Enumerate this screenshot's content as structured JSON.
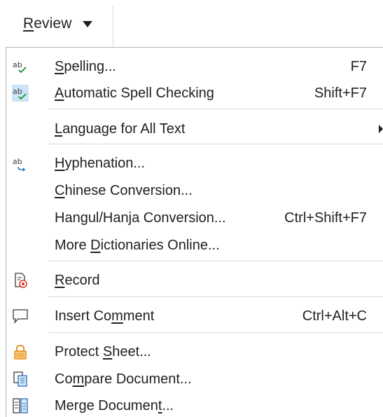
{
  "review_menu": {
    "label_first": "R",
    "label_rest": "eview",
    "caret": "chevron-down-icon"
  },
  "items": [
    {
      "pre": "",
      "u": "S",
      "post": "pelling...",
      "shortcut": "F7",
      "icon": "spelling-icon"
    },
    {
      "pre": "",
      "u": "A",
      "post": "utomatic Spell Checking",
      "shortcut": "Shift+F7",
      "icon": "auto-spellcheck-icon",
      "checked": true
    },
    {
      "pre": "",
      "u": "L",
      "post": "anguage for All Text",
      "shortcut": "",
      "icon": "",
      "submenu": true
    },
    {
      "pre": "",
      "u": "H",
      "post": "yphenation...",
      "shortcut": "",
      "icon": "hyphenation-icon"
    },
    {
      "pre": "",
      "u": "C",
      "post": "hinese Conversion...",
      "shortcut": "",
      "icon": ""
    },
    {
      "pre": "Hangul/Han",
      "u": "j",
      "post": "a Conversion...",
      "shortcut": "Ctrl+Shift+F7",
      "icon": ""
    },
    {
      "pre": "More ",
      "u": "D",
      "post": "ictionaries Online...",
      "shortcut": "",
      "icon": ""
    },
    {
      "pre": "",
      "u": "R",
      "post": "ecord",
      "shortcut": "",
      "icon": "record-changes-icon"
    },
    {
      "pre": "Insert Co",
      "u": "m",
      "post": "ment",
      "shortcut": "Ctrl+Alt+C",
      "icon": "comment-icon"
    },
    {
      "pre": "Protect ",
      "u": "S",
      "post": "heet...",
      "shortcut": "",
      "icon": "lock-icon"
    },
    {
      "pre": "Co",
      "u": "m",
      "post": "pare Document...",
      "shortcut": "",
      "icon": "compare-document-icon"
    },
    {
      "pre": "Merge Documen",
      "u": "t",
      "post": "...",
      "shortcut": "",
      "icon": "merge-document-icon"
    }
  ],
  "colors": {
    "text": "#1f1f1f",
    "separator": "#d6d6d6",
    "check_highlight": "#cde4f7",
    "spell_green": "#2e9e4a",
    "lock_orange": "#e8891c",
    "record_red": "#d9342b",
    "icon_blue": "#2a6fb8"
  }
}
